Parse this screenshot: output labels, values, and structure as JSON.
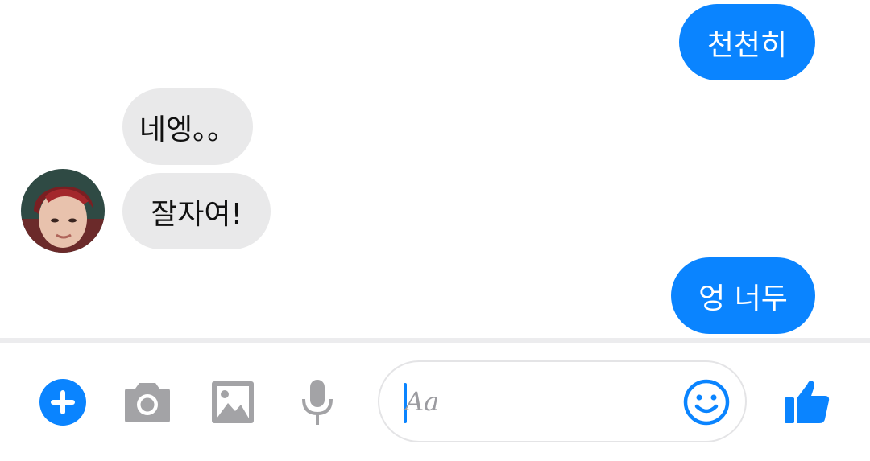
{
  "messages": [
    {
      "direction": "outgoing",
      "text": "천천히"
    },
    {
      "direction": "incoming",
      "text": "네엥。。"
    },
    {
      "direction": "incoming",
      "text": "잘자여!"
    },
    {
      "direction": "outgoing",
      "text": "엉 너두"
    }
  ],
  "composer": {
    "placeholder": "Aa",
    "icons": [
      "plus-icon",
      "camera-icon",
      "image-icon",
      "microphone-icon",
      "emoji-icon",
      "thumbs-up-icon"
    ]
  },
  "colors": {
    "accent": "#0a84ff",
    "incoming_bubble": "#e9e9ea",
    "icon_gray": "#a3a3a6"
  }
}
